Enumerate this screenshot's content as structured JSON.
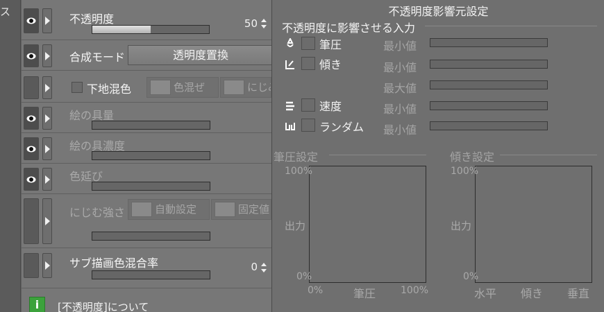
{
  "sidebar": {
    "text": "ス"
  },
  "panel": {
    "opacity": {
      "label": "不透明度",
      "value": "50",
      "fill_fraction": 0.5
    },
    "blend": {
      "label": "合成モード",
      "value": "透明度置換"
    },
    "underlay": {
      "label": "下地混色",
      "btn1": "色混ぜ",
      "btn2": "にじみ"
    },
    "paint_amount": {
      "label": "絵の具量"
    },
    "paint_density": {
      "label": "絵の具濃度"
    },
    "color_stretch": {
      "label": "色延び"
    },
    "blur_strength": {
      "label": "にじむ強さ",
      "btn1": "自動設定",
      "btn2": "固定値"
    },
    "sub_color_mix": {
      "label": "サブ描画色混合率",
      "value": "0"
    },
    "info": {
      "icon_letter": "i",
      "text": "[不透明度]について"
    }
  },
  "popup": {
    "title": "不透明度影響元設定",
    "section_inputs": "不透明度に影響させる入力",
    "inputs": [
      {
        "label": "筆圧",
        "min_label": "最小値"
      },
      {
        "label": "傾き",
        "min_label": "最小値"
      },
      {
        "label": "",
        "min_label": "最大値"
      },
      {
        "label": "速度",
        "min_label": "最小値"
      },
      {
        "label": "ランダム",
        "min_label": "最小値"
      }
    ],
    "pressure_graph": {
      "title": "筆圧設定",
      "y_top": "100%",
      "y_mid": "出力",
      "y_bottom": "0%",
      "x_left": "0%",
      "x_mid": "筆圧",
      "x_right": "100%"
    },
    "tilt_graph": {
      "title": "傾き設定",
      "y_top": "100%",
      "y_mid": "出力",
      "y_bottom": "0%",
      "x_left": "水平",
      "x_mid": "傾き",
      "x_right": "垂直"
    }
  }
}
